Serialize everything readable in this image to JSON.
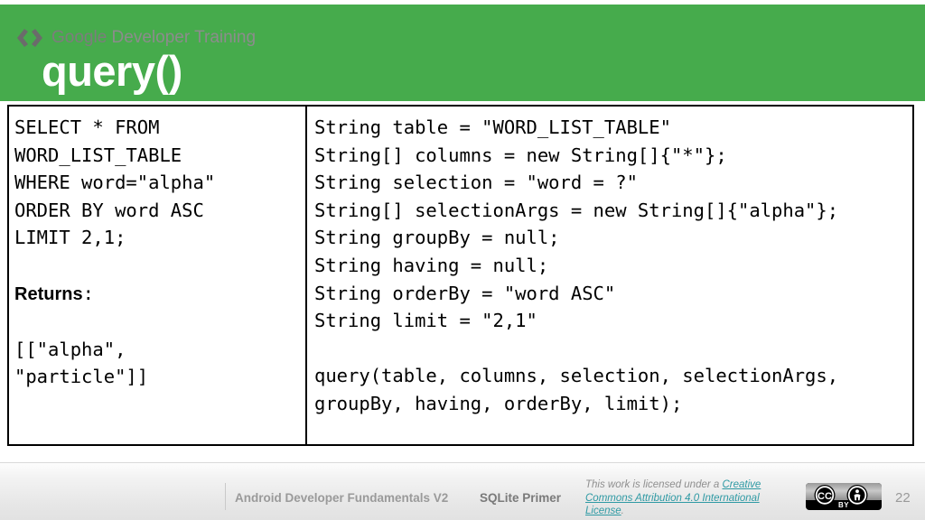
{
  "slide": {
    "title": "query()",
    "header_color": "#46ab4c"
  },
  "sql_panel": {
    "code": "SELECT * FROM\nWORD_LIST_TABLE\nWHERE word=\"alpha\"\nORDER BY word ASC\nLIMIT 2,1;",
    "returns_label": "Returns",
    "returns_colon": ":",
    "returns_value": "[[\"alpha\",\n\"particle\"]]"
  },
  "java_panel": {
    "declarations": "String table = \"WORD_LIST_TABLE\"\nString[] columns = new String[]{\"*\"};\nString selection = \"word = ?\"\nString[] selectionArgs = new String[]{\"alpha\"};\nString groupBy = null;\nString having = null;\nString orderBy = \"word ASC\"\nString limit = \"2,1\"",
    "call": "query(table, columns, selection, selectionArgs,\ngroupBy, having, orderBy, limit);"
  },
  "footer": {
    "logo_brand": "Google",
    "logo_suffix": " Developer Training",
    "course": "Android Developer Fundamentals V2",
    "lesson": "SQLite Primer",
    "license_prefix": "This work is licensed under a ",
    "license_link": "Creative Commons Attribution 4.0 International License",
    "license_suffix": ".",
    "license_link_color": "#2f9aa4",
    "cc_by_label": "BY",
    "page_number": "22"
  }
}
